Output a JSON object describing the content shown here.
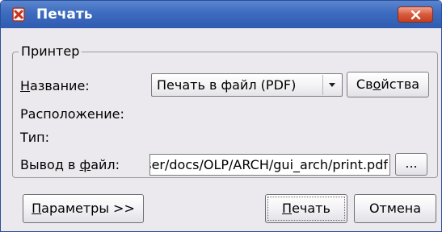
{
  "window": {
    "title": "Печать",
    "title_bar_color": "#3d6bbf",
    "close_button_color": "#d9593d"
  },
  "printer_group": {
    "title": "Принтер",
    "name_label": {
      "accel": "Н",
      "rest": "азвание:"
    },
    "printer_select_value": "Печать в файл (PDF)",
    "properties_button": {
      "before": "Св",
      "accel": "о",
      "after": "йства"
    },
    "location_label": "Расположение:",
    "type_label": "Тип:",
    "output_label": {
      "before": "Вывод в ",
      "accel": "ф",
      "after": "айл:"
    },
    "output_file_value": "/home/user/docs/OLP/ARCH/gui_arch/print.pdf",
    "browse_button": "..."
  },
  "buttons": {
    "options": {
      "accel": "П",
      "rest": "араметры >>"
    },
    "print": {
      "accel": "П",
      "rest": "ечать"
    },
    "cancel": "Отмена"
  }
}
